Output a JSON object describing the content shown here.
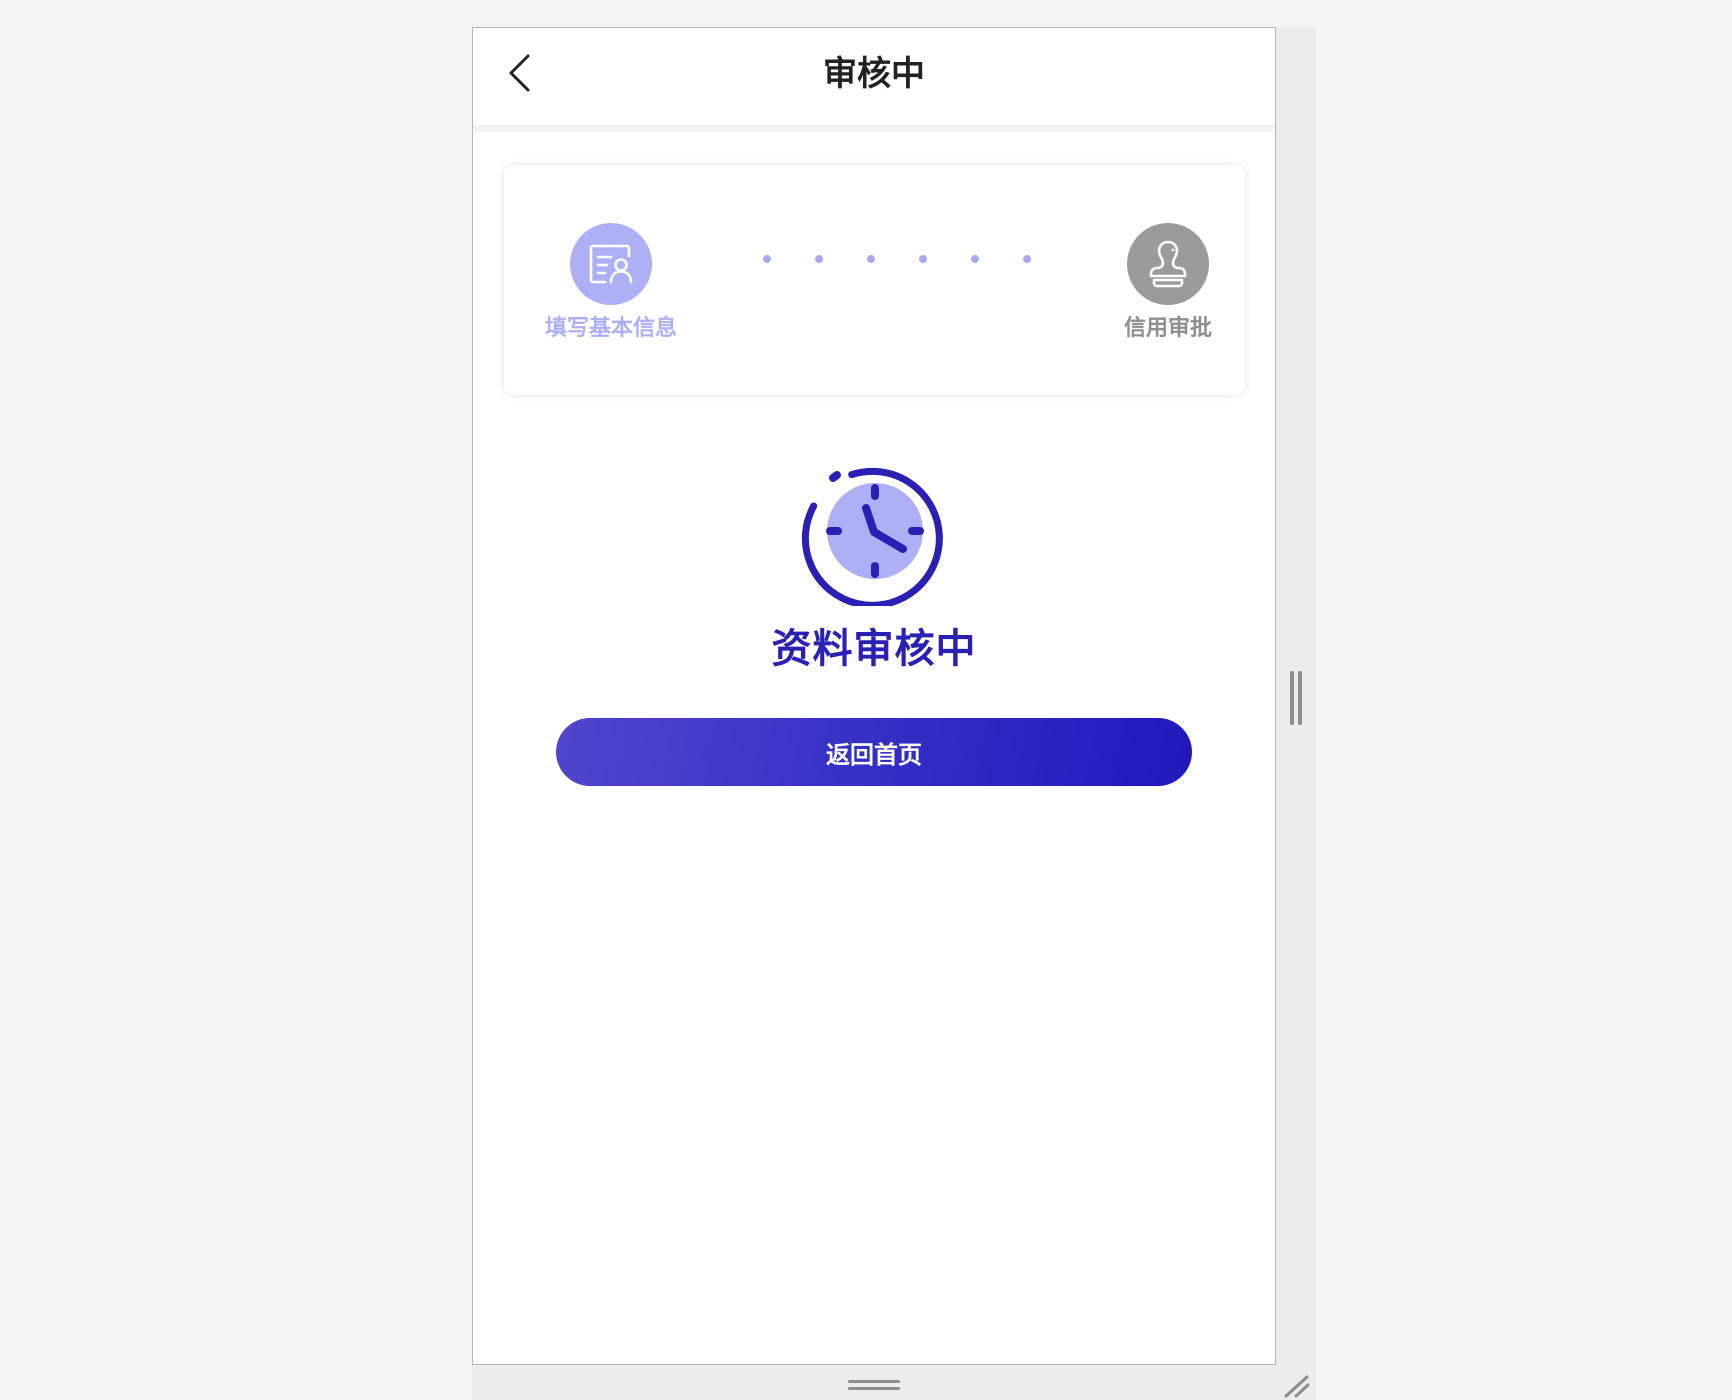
{
  "nav": {
    "title": "审核中",
    "back_icon": "chevron-left-icon"
  },
  "steps": [
    {
      "label": "填写基本信息",
      "icon": "id-card-icon",
      "state": "completed",
      "color": "#adb0f5"
    },
    {
      "label": "信用审批",
      "icon": "stamp-icon",
      "state": "pending",
      "color": "#9b9b9b"
    }
  ],
  "status": {
    "icon": "clock-icon",
    "title": "资料审核中",
    "color": "#2a20b4"
  },
  "actions": {
    "home_label": "返回首页"
  },
  "colors": {
    "accent": "#2a20b4",
    "accent_light": "#adb0f5",
    "inactive": "#9b9b9b",
    "background": "#f4f4f4"
  }
}
